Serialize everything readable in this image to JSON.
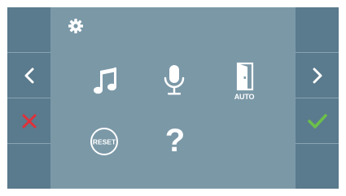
{
  "screen": {
    "colors": {
      "background": "#7b98a7",
      "side_panel": "#5a7a8d",
      "cancel": "#e0313a",
      "confirm": "#6cc04a",
      "icon": "#ffffff"
    },
    "header_icon": "gear-icon",
    "menu_items": [
      {
        "icon": "music-note-icon",
        "label": ""
      },
      {
        "icon": "microphone-icon",
        "label": ""
      },
      {
        "icon": "door-auto-icon",
        "label": "AUTO"
      },
      {
        "icon": "reset-icon",
        "label": "RESET"
      },
      {
        "icon": "help-icon",
        "label": "?"
      }
    ],
    "left_panel": [
      "empty",
      "chevron-left-icon",
      "close-icon",
      "empty"
    ],
    "right_panel": [
      "empty",
      "chevron-right-icon",
      "check-icon",
      "empty"
    ]
  }
}
